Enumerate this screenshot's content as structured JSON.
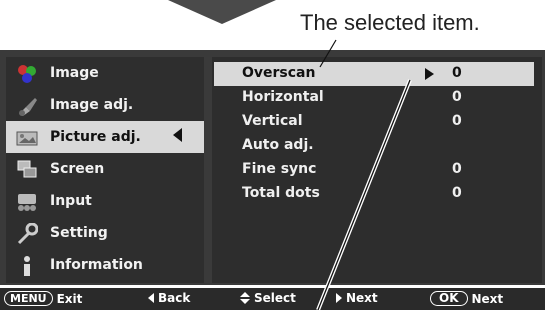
{
  "callout": {
    "text": "The selected item."
  },
  "menu": {
    "items": [
      {
        "label": "Image",
        "icon": "color-balls-icon"
      },
      {
        "label": "Image adj.",
        "icon": "brush-icon"
      },
      {
        "label": "Picture adj.",
        "icon": "picture-icon",
        "selected": true
      },
      {
        "label": "Screen",
        "icon": "screen-icon"
      },
      {
        "label": "Input",
        "icon": "input-icon"
      },
      {
        "label": "Setting",
        "icon": "wrench-icon"
      },
      {
        "label": "Information",
        "icon": "info-icon"
      }
    ]
  },
  "submenu": {
    "rows": [
      {
        "name": "Overscan",
        "value": "0",
        "selected": true
      },
      {
        "name": "Horizontal",
        "value": "0"
      },
      {
        "name": "Vertical",
        "value": "0"
      },
      {
        "name": "Auto adj.",
        "value": ""
      },
      {
        "name": "Fine sync",
        "value": "0"
      },
      {
        "name": "Total dots",
        "value": "0"
      }
    ]
  },
  "footer": {
    "menu_key": "MENU",
    "exit": "Exit",
    "back": "Back",
    "select": "Select",
    "next": "Next",
    "ok_key": "OK",
    "ok_next": "Next"
  },
  "colors": {
    "panel": "#2d2d2d",
    "highlight": "#d9d9d9",
    "text": "#f0f0f0"
  }
}
